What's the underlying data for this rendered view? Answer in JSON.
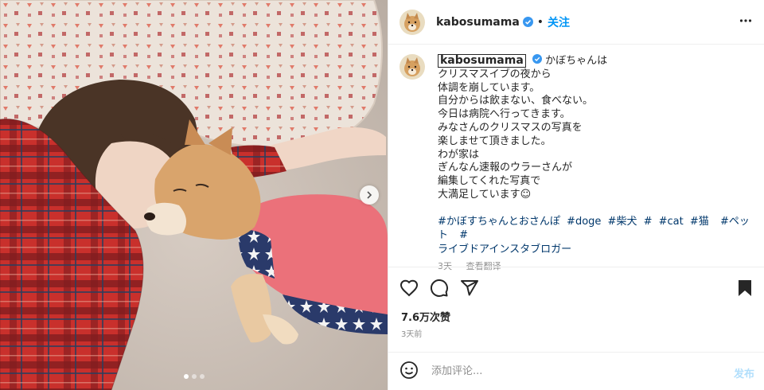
{
  "header": {
    "username": "kabosumama",
    "separator": "•",
    "follow_label": "关注",
    "more_icon": "more-horizontal-icon",
    "verified_icon": "verified-badge-icon"
  },
  "caption": {
    "username": "kabosumama",
    "lines": [
      "かぼちゃんは",
      "クリスマスイブの夜から",
      "体調を崩しています。",
      "自分からは飲まない、食べない。",
      "今日は病院へ行ってきます。",
      "みなさんのクリスマスの写真を",
      "楽しませて頂きました。",
      "わが家は",
      "ぎんなん速報のウラーさんが",
      "編集してくれた写真で",
      "大満足しています☺"
    ],
    "hashtags": [
      "#かぼすちゃんとおさんぽ",
      "#doge",
      "#柴犬",
      "#",
      "#cat",
      "#猫",
      "#ペット",
      "#",
      "ライブドアインスタブロガー"
    ],
    "time": "3天",
    "translate_label": "查看翻译"
  },
  "actions": {
    "like_icon": "heart-icon",
    "comment_icon": "comment-icon",
    "share_icon": "share-icon",
    "save_icon": "bookmark-icon"
  },
  "likes": "7.6万次赞",
  "posted": "3天前",
  "comment": {
    "placeholder": "添加评论...",
    "post_label": "发布",
    "emoji_icon": "emoji-icon"
  },
  "media": {
    "carousel_count": 3,
    "active_index": 0,
    "next_icon": "chevron-right-icon"
  },
  "colors": {
    "accent": "#0095f6",
    "hashtag": "#00376b",
    "muted": "#8e8e8e",
    "post_disabled": "#b2dffc"
  }
}
